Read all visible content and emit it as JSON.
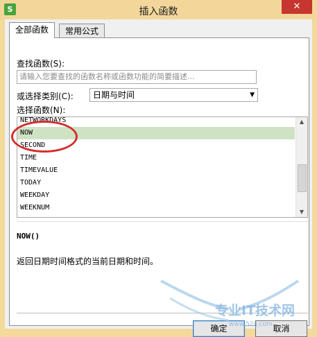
{
  "window": {
    "title": "插入函数",
    "app_icon_text": "S",
    "close_symbol": "✕"
  },
  "tabs": [
    {
      "label": "全部函数",
      "active": true
    },
    {
      "label": "常用公式",
      "active": false
    }
  ],
  "search": {
    "label": "查找函数(S):",
    "placeholder": "请输入您要查找的函数名称或函数功能的简要描述..."
  },
  "category": {
    "label": "或选择类别(C):",
    "selected": "日期与时间"
  },
  "function_list": {
    "label": "选择函数(N):",
    "items": [
      "NETWORKDAYS",
      "NOW",
      "SECOND",
      "TIME",
      "TIMEVALUE",
      "TODAY",
      "WEEKDAY",
      "WEEKNUM"
    ],
    "selected_index": 1
  },
  "details": {
    "signature": "NOW()",
    "description": "返回日期时间格式的当前日期和时间。"
  },
  "buttons": {
    "ok": "确定",
    "cancel": "取消"
  },
  "watermark": {
    "text": "专业IT技术网",
    "url": "www.52ij.com"
  },
  "colors": {
    "title_bar": "#f3d79a",
    "close_button": "#c7352f",
    "selection": "#cfe3c4",
    "annotation": "#d42d2d"
  }
}
